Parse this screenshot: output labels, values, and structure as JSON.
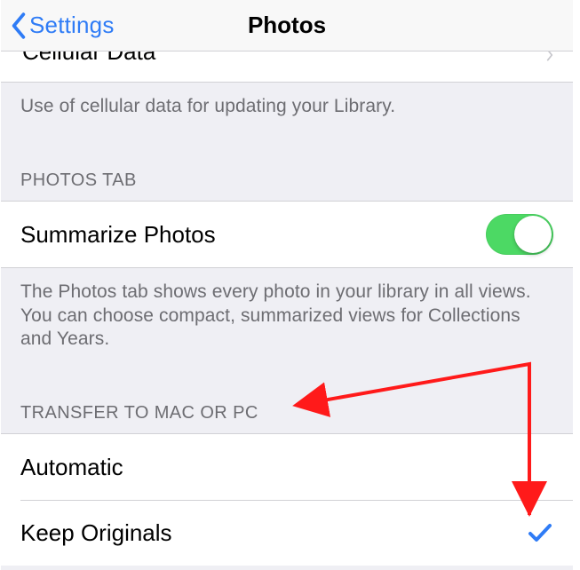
{
  "nav": {
    "back_label": "Settings",
    "title": "Photos"
  },
  "cutoff_cell": {
    "label": "Cellular Data"
  },
  "cellular_footer": "Use of cellular data for updating your Library.",
  "photos_tab": {
    "header": "PHOTOS TAB",
    "summarize_label": "Summarize Photos",
    "summarize_on": true,
    "footer": "The Photos tab shows every photo in your library in all views. You can choose compact, summarized views for Collections and Years."
  },
  "transfer": {
    "header": "TRANSFER TO MAC OR PC",
    "options": [
      {
        "label": "Automatic",
        "selected": false
      },
      {
        "label": "Keep Originals",
        "selected": true
      }
    ]
  },
  "colors": {
    "tint": "#2f7cf6",
    "switch_on": "#4cd964",
    "annotation": "#ff1a1a"
  }
}
